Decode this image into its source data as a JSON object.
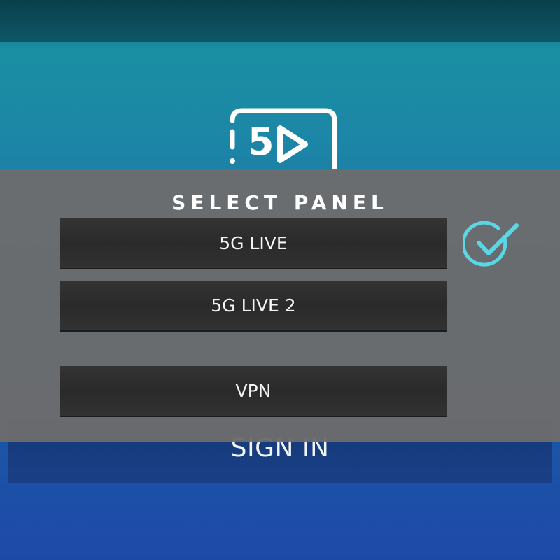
{
  "app": {
    "logo_text": "5D"
  },
  "signin": {
    "label": "SIGN IN"
  },
  "dialog": {
    "title": "SELECT PANEL",
    "options": [
      {
        "label": "5G LIVE",
        "selected": true
      },
      {
        "label": "5G LIVE 2",
        "selected": false
      },
      {
        "label": "VPN",
        "selected": false
      }
    ],
    "check_icon": "checkmark-circle-icon",
    "accent_color": "#5ad7e6"
  }
}
